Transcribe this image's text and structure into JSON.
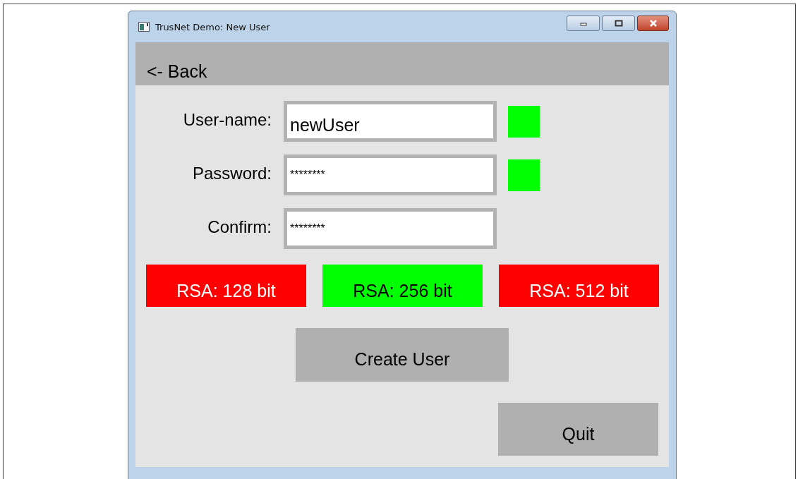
{
  "window": {
    "title": "TrusNet Demo: New User"
  },
  "back_button": {
    "label": "<- Back"
  },
  "fields": [
    {
      "label": "User-name:",
      "value": "newUser",
      "kind": "text",
      "valid": true
    },
    {
      "label": "Password:",
      "value": "********",
      "kind": "password",
      "valid": true
    },
    {
      "label": "Confirm:",
      "value": "********",
      "kind": "password"
    }
  ],
  "key_sizes": [
    {
      "label": "RSA: 128 bit",
      "selected": false
    },
    {
      "label": "RSA: 256 bit",
      "selected": true
    },
    {
      "label": "RSA: 512 bit",
      "selected": false
    }
  ],
  "create_button": {
    "label": "Create User"
  },
  "quit_button": {
    "label": "Quit"
  }
}
